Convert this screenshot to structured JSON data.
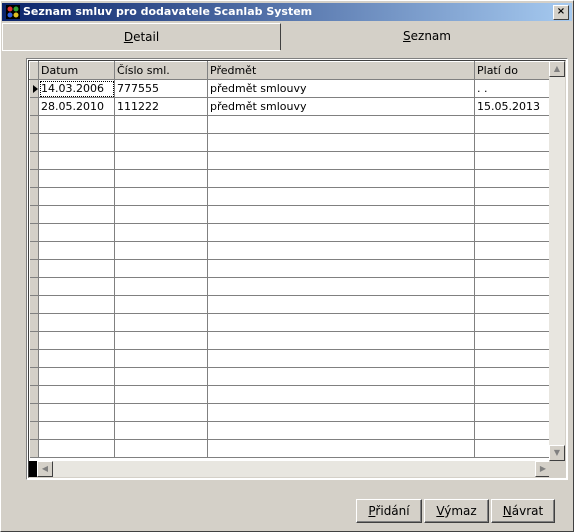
{
  "window": {
    "title": "Seznam smluv pro dodavatele Scanlab System",
    "close_glyph": "×"
  },
  "tabs": [
    {
      "label": "Detail",
      "underline_char": "D",
      "rest": "etail",
      "active": false
    },
    {
      "label": "Seznam",
      "underline_char": "S",
      "rest": "eznam",
      "active": true
    }
  ],
  "grid": {
    "columns": [
      "Datum",
      "Číslo sml.",
      "Předmět",
      "Platí do"
    ],
    "rows": [
      [
        "14.03.2006",
        "777555",
        "předmět smlouvy",
        ". ."
      ],
      [
        "28.05.2010",
        "111222",
        "předmět smlouvy",
        "15.05.2013"
      ]
    ],
    "empty_rows": 19,
    "scroll_up": "▲",
    "scroll_down": "▼",
    "scroll_left": "◀",
    "scroll_right": "▶"
  },
  "buttons": [
    {
      "label": "Přidání",
      "underline_char": "P",
      "rest": "řidání"
    },
    {
      "label": "Výmaz",
      "underline_char": "V",
      "rest": "ýmaz"
    },
    {
      "label": "Návrat",
      "underline_char": "N",
      "rest": "ávrat"
    }
  ],
  "colors": {
    "titlebar_start": "#0a246a",
    "titlebar_end": "#a6caf0",
    "face": "#d4d0c8"
  }
}
